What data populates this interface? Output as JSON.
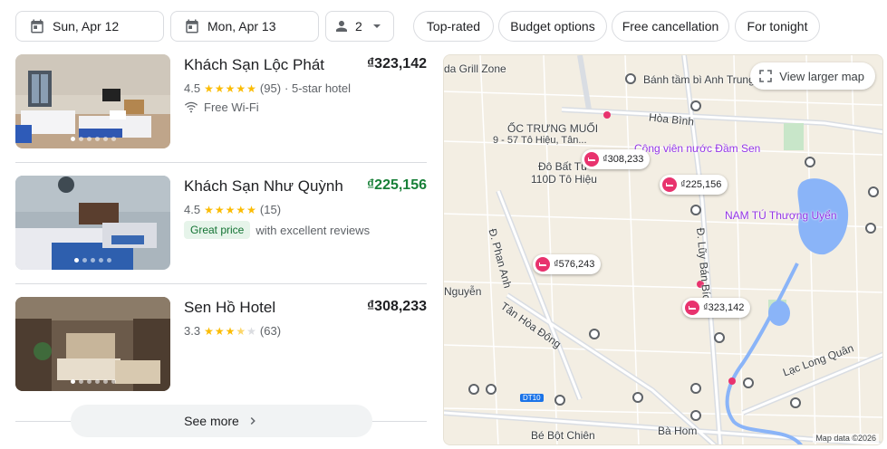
{
  "filters": {
    "checkin": "Sun, Apr 12",
    "checkout": "Mon, Apr 13",
    "guests": "2",
    "chips": [
      "Top-rated",
      "Budget options",
      "Free cancellation",
      "For tonight"
    ]
  },
  "hotels": [
    {
      "name": "Khách Sạn Lộc Phát",
      "price": "₫323,142",
      "rating": "4.5",
      "reviews": "(95)",
      "star_class": "· 5-star hotel",
      "stars": 4.5,
      "amenity": "Free Wi-Fi"
    },
    {
      "name": "Khách Sạn Như Quỳnh",
      "price": "₫225,156",
      "rating": "4.5",
      "reviews": "(15)",
      "stars": 4.5,
      "badge": "Great price",
      "badge_note": "with excellent reviews"
    },
    {
      "name": "Sen Hồ Hotel",
      "price": "₫308,233",
      "rating": "3.3",
      "reviews": "(63)",
      "stars": 3.5
    }
  ],
  "see_more": "See more",
  "map": {
    "view_larger": "View larger map",
    "map_data": "Map data ©2026",
    "price_pins": [
      "₫308,233",
      "₫225,156",
      "₫576,243",
      "₫323,142"
    ],
    "labels": {
      "grill": "da Grill Zone",
      "banh_tam": "Bánh tầm bì Anh Trung",
      "hoa_binh": "Hòa Bình",
      "oc_trung": "ỐC TRƯNG MUỐI",
      "oc_trung_addr": "9 - 57 Tô Hiệu, Tân...",
      "do_bat": "Đô Bất Tử",
      "do_bat_addr": "110D Tô Hiệu",
      "cong_vien": "Công viên nước Đầm Sen",
      "nam_tu": "NAM TÚ Thượng Uyển",
      "phan_anh": "Đ. Phan Anh",
      "luy_ban_bich": "Đ. Lũy Bán Bích",
      "nguyen": "Nguyễn",
      "tan_hoa_dong": "Tân Hòa Đông",
      "lac_long_quan": "Lạc Long Quân",
      "dt10": "DT10",
      "be_bot_chien": "Bé Bột Chiên",
      "ba_hom": "Bà Hom"
    }
  }
}
